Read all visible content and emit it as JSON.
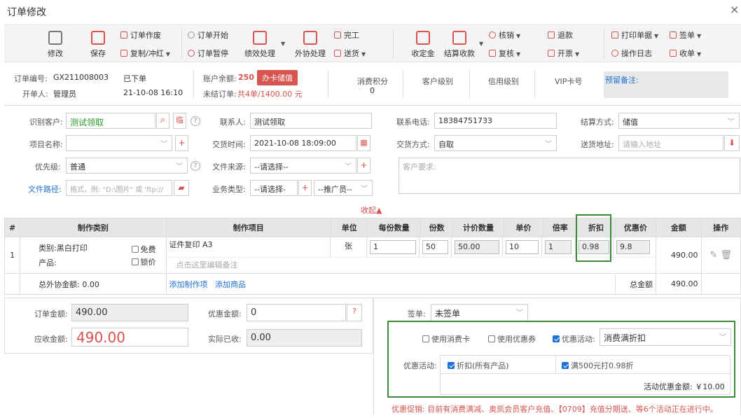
{
  "window": {
    "title": "订单修改",
    "close": "×"
  },
  "toolbar": {
    "edit": "修改",
    "save": "保存",
    "order_void": "订单作废",
    "copy_reverse": "复制/冲红",
    "order_start": "订单开始",
    "order_pause": "订单暂停",
    "perf": "绩效处理",
    "outsource": "外协处理",
    "finish": "完工",
    "delivery": "送货",
    "deposit": "收定金",
    "settle": "结算收款",
    "verify": "核销",
    "review": "复核",
    "refund": "退款",
    "invoice": "开票",
    "print": "打印单据",
    "op_log": "操作日志",
    "sign": "签单",
    "receipt": "收单"
  },
  "header": {
    "order_no_label": "订单编号:",
    "order_no": "GX211008003",
    "status": "已下单",
    "creator_label": "开单人:",
    "creator": "管理员",
    "created_at": "21-10-08 16:10",
    "balance_label": "账户余额:",
    "balance": "250",
    "card_btn": "办卡储值",
    "unsettled_label": "未结订单:",
    "unsettled": "共4单/1400.00 元",
    "points_label": "消费积分",
    "points": "0",
    "cust_level_label": "客户级别",
    "credit_label": "信用级别",
    "vip_label": "VIP卡号",
    "remark_label": "预留备注:"
  },
  "form": {
    "customer_label": "识别客户:",
    "customer": "测试领取",
    "temp_btn": "临",
    "contact_label": "联系人:",
    "contact": "测试领取",
    "phone_label": "联系电话:",
    "phone": "18384751733",
    "settle_label": "结算方式:",
    "settle": "储值",
    "project_label": "项目名称:",
    "delivery_time_label": "交货时间:",
    "delivery_time": "2021-10-08 18:09:00",
    "delivery_mode_label": "交货方式:",
    "delivery_mode": "自取",
    "address_label": "送货地址:",
    "address_ph": "请输入地址",
    "priority_label": "优先级:",
    "priority": "普通",
    "source_label": "文件来源:",
    "source": "--请选择--",
    "customer_req_ph": "客户要求:",
    "filepath_label": "文件路径:",
    "filepath_ph": "格式，例: \"D:\\图片\" 或 'ftp://",
    "biz_label": "业务类型:",
    "biz": "--请选择-",
    "promoter": "--推广员--",
    "collapse": "收起▲"
  },
  "table": {
    "headers": [
      "#",
      "制作类别",
      "制作项目",
      "单位",
      "每份数量",
      "份数",
      "计价数量",
      "单价",
      "倍率",
      "折扣",
      "优惠价",
      "金额",
      "操作"
    ],
    "row": {
      "index": "1",
      "category": "类别:黑白打印",
      "product_label": "产品:",
      "free": "免费",
      "lock_price": "锁价",
      "item": "证件复印 A3",
      "remark_ph": "点击这里编辑备注",
      "unit": "张",
      "qty_per": "1",
      "copies": "50",
      "price_qty": "50.00",
      "unit_price": "10",
      "rate": "1",
      "discount": "0.98",
      "disc_price": "9.8",
      "amount": "490.00"
    },
    "outsource_total": "总外协金额:  0.00",
    "add_item": "添加制作项",
    "add_product": "添加商品",
    "total_label": "总金额",
    "total": "490.00"
  },
  "summary": {
    "order_amount_label": "订单金额:",
    "order_amount": "490.00",
    "discount_amount_label": "优惠金额:",
    "discount_amount": "0",
    "receivable_label": "应收金额:",
    "receivable": "490.00",
    "paid_label": "实际已收:",
    "paid": "0.00",
    "sign_label": "签单:",
    "sign": "未签单"
  },
  "promo": {
    "use_card": "使用消费卡",
    "use_coupon": "使用优惠券",
    "promo_activity": "优惠活动:",
    "promo_select": "消费满折扣",
    "promo_label": "优惠活动:",
    "promo1": "折扣(所有产品)",
    "promo2": "满500元打0.98折",
    "promo_total": "活动优惠金额: ￥10.00",
    "notice": "优惠促销: 目前有消费满减、奥凯会员客户充值、【0709】充值分期送、等6个活动正在进行中。"
  }
}
